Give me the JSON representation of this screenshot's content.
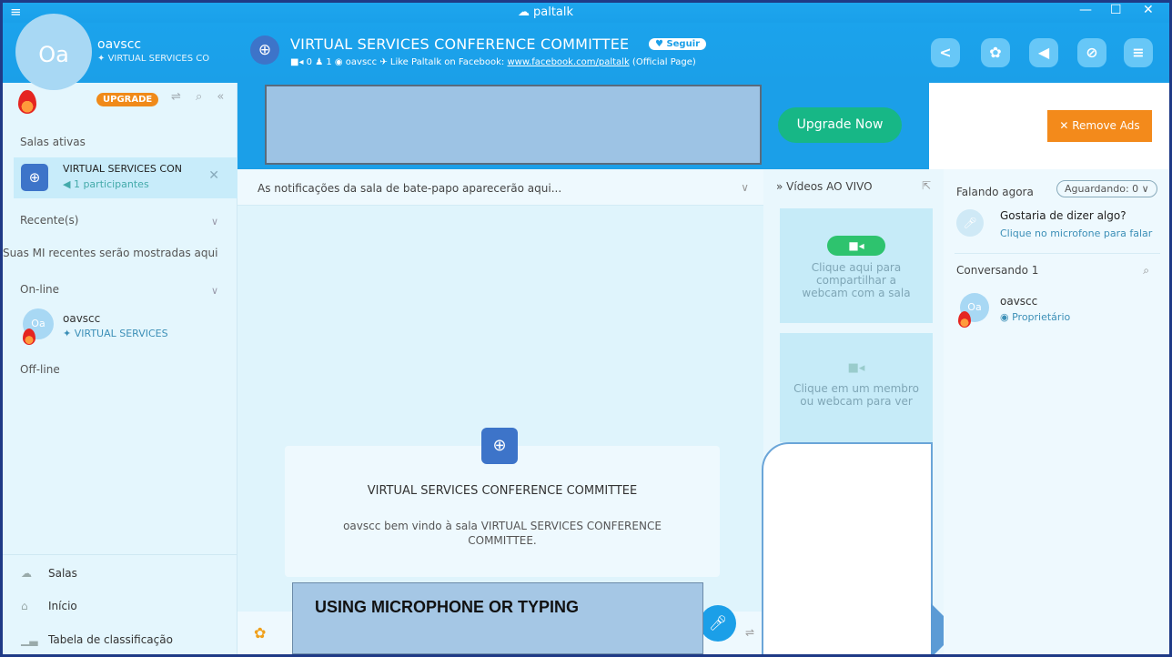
{
  "titlebar": {
    "app": "paltalk",
    "menu": "≡",
    "min": "—",
    "max": "☐",
    "close": "✕"
  },
  "user": {
    "name": "oavscc",
    "initials": "Oa",
    "room": "VIRTUAL SERVICES CO"
  },
  "room": {
    "title": "VIRTUAL SERVICES CONFERENCE COMMITTEE",
    "follow": "♥ Seguir",
    "meta_counts": "■◂ 0  ♟ 1  ◉ oavscc",
    "meta_like": "✈ Like Paltalk on Facebook:",
    "meta_link": "www.facebook.com/paltalk",
    "meta_tail": "(Official Page)"
  },
  "sidebar": {
    "upgrade": "UPGRADE",
    "active_header": "Salas ativas",
    "active_room": "VIRTUAL SERVICES CON",
    "active_participants": "◀ 1 participantes",
    "recent_header": "Recente(s)",
    "recent_empty": "Suas MI recentes serão mostradas aqui",
    "online_header": "On-line",
    "online_user": "oavscc",
    "online_room": "✦ VIRTUAL SERVICES",
    "offline_header": "Off-line",
    "nav": [
      "Salas",
      "Início",
      "Tabela de classificação"
    ]
  },
  "ads": {
    "upgrade_now": "Upgrade Now",
    "remove_ads": "✕ Remove Ads"
  },
  "chat": {
    "notifications": "As notificações da sala de bate-papo aparecerão aqui...",
    "welcome_title": "VIRTUAL SERVICES CONFERENCE COMMITTEE",
    "welcome_text": "oavscc bem vindo à sala VIRTUAL SERVICES CONFERENCE COMMITTEE.",
    "caption": "USING MICROPHONE OR TYPING"
  },
  "videos": {
    "header": "Vídeos AO VIVO",
    "share": "Clique aqui para compartilhar a webcam com a sala",
    "view": "Clique em um membro ou webcam para ver"
  },
  "right": {
    "speaking": "Falando agora",
    "waiting": "Aguardando: 0 ∨",
    "say_title": "Gostaria de dizer algo?",
    "say_sub": "Clique no microfone para falar",
    "conversing": "Conversando  1",
    "user": "oavscc",
    "role": "◉ Proprietário"
  }
}
